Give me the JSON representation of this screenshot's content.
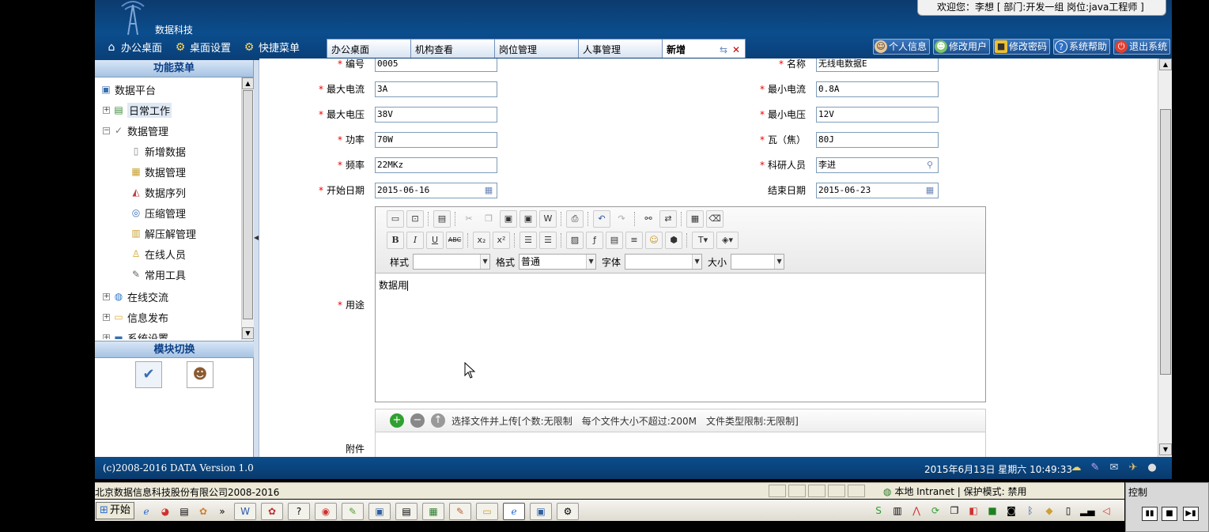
{
  "header": {
    "brand": "数据科技",
    "welcome": "欢迎您：李想 [ 部门:开发一组 岗位:java工程师 ]",
    "topnav": [
      {
        "label": "办公桌面",
        "icon": "house-icon"
      },
      {
        "label": "桌面设置",
        "icon": "desk-settings-icon"
      },
      {
        "label": "快捷菜单",
        "icon": "shortcut-menu-icon"
      }
    ],
    "tabs": [
      {
        "label": "办公桌面"
      },
      {
        "label": "机构查看"
      },
      {
        "label": "岗位管理"
      },
      {
        "label": "人事管理"
      },
      {
        "label": "新增",
        "active": true
      }
    ],
    "rightnav": [
      {
        "label": "个人信息",
        "icon": "person-info-icon"
      },
      {
        "label": "修改用户",
        "icon": "users-icon"
      },
      {
        "label": "修改密码",
        "icon": "lock-icon"
      },
      {
        "label": "系统帮助",
        "icon": "help-icon"
      },
      {
        "label": "退出系统",
        "icon": "power-icon"
      }
    ]
  },
  "sidebar": {
    "title": "功能菜单",
    "tree": [
      {
        "label": "数据平台",
        "icon": "computer-icon"
      },
      {
        "label": "日常工作",
        "icon": "daily-work-icon"
      },
      {
        "label": "数据管理",
        "icon": "data-manage-icon"
      },
      {
        "label": "新增数据",
        "icon": "new-doc-icon"
      },
      {
        "label": "数据管理",
        "icon": "data-table-icon"
      },
      {
        "label": "数据序列",
        "icon": "chart-icon"
      },
      {
        "label": "压缩管理",
        "icon": "disc-icon"
      },
      {
        "label": "解压解管理",
        "icon": "unpack-icon"
      },
      {
        "label": "在线人员",
        "icon": "online-person-icon"
      },
      {
        "label": "常用工具",
        "icon": "pen-icon"
      },
      {
        "label": "在线交流",
        "icon": "globe-icon"
      },
      {
        "label": "信息发布",
        "icon": "folder-icon"
      },
      {
        "label": "系统设置",
        "icon": "settings-icon"
      }
    ],
    "module_title": "模块切换"
  },
  "form": {
    "code": {
      "label": "编号",
      "value": "0005"
    },
    "name": {
      "label": "名称",
      "value": "无线电数据E"
    },
    "max_current": {
      "label": "最大电流",
      "value": "3A"
    },
    "min_current": {
      "label": "最小电流",
      "value": "0.8A"
    },
    "max_voltage": {
      "label": "最大电压",
      "value": "38V"
    },
    "min_voltage": {
      "label": "最小电压",
      "value": "12V"
    },
    "power": {
      "label": "功率",
      "value": "70W"
    },
    "energy": {
      "label": "瓦（焦）",
      "value": "80J"
    },
    "frequency": {
      "label": "频率",
      "value": "22MKz"
    },
    "researcher": {
      "label": "科研人员",
      "value": "李进"
    },
    "start_date": {
      "label": "开始日期",
      "value": "2015-06-16"
    },
    "end_date": {
      "label": "结束日期",
      "value": "2015-06-23"
    },
    "purpose": {
      "label": "用途",
      "value": "数据用"
    },
    "attachment": {
      "label": "附件"
    }
  },
  "editor": {
    "style_label": "样式",
    "format_label": "格式",
    "format_value": "普通",
    "font_label": "字体",
    "size_label": "大小"
  },
  "uploader": {
    "text": "选择文件并上传[个数:无限制　每个文件大小不超过:200M　文件类型限制:无限制]"
  },
  "footer": {
    "copyright": "(c)2008-2016 DATA Version 1.0",
    "datetime": "2015年6月13日 星期六 10:49:33"
  },
  "browser": {
    "status_left": "北京数据信息科技股份有限公司2008-2016",
    "zone": "本地 Intranet | 保护模式: 禁用",
    "control_title": "控制",
    "start_label": "开始"
  }
}
